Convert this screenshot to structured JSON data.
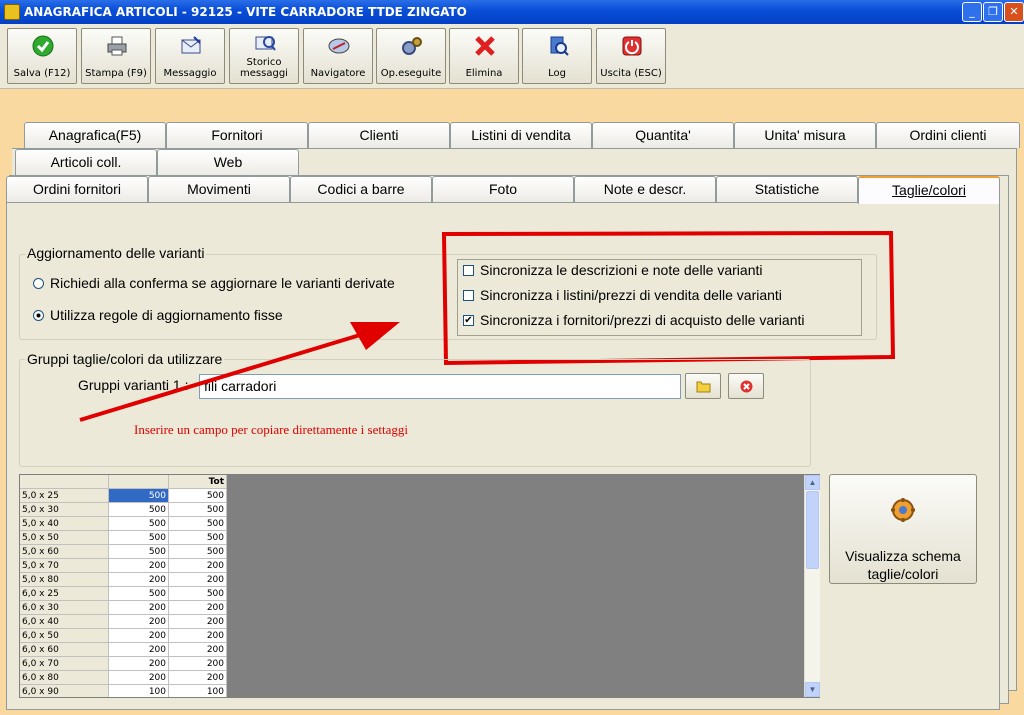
{
  "window": {
    "title": "ANAGRAFICA ARTICOLI - 92125 - VITE CARRADORE TTDE ZINGATO",
    "min": "_",
    "max": "❐",
    "close": "✕"
  },
  "toolbar": [
    {
      "label1": "Salva (F12)",
      "label2": "",
      "icon": "check-icon"
    },
    {
      "label1": "Stampa (F9)",
      "label2": "",
      "icon": "printer-icon"
    },
    {
      "label1": "Messaggio",
      "label2": "",
      "icon": "message-icon"
    },
    {
      "label1": "Storico",
      "label2": "messaggi",
      "icon": "message-history-icon"
    },
    {
      "label1": "Navigatore",
      "label2": "",
      "icon": "compass-icon"
    },
    {
      "label1": "Op.eseguite",
      "label2": "",
      "icon": "gears-icon"
    },
    {
      "label1": "Elimina",
      "label2": "",
      "icon": "delete-icon"
    },
    {
      "label1": "Log",
      "label2": "",
      "icon": "log-icon"
    },
    {
      "label1": "Uscita (ESC)",
      "label2": "",
      "icon": "power-icon"
    }
  ],
  "tabs": {
    "row1": [
      "Anagrafica(F5)",
      "Fornitori",
      "Clienti",
      "Listini di vendita",
      "Quantita'",
      "Unita' misura",
      "Ordini clienti"
    ],
    "row2": [
      "Articoli coll.",
      "Web"
    ],
    "row3": [
      "Ordini fornitori",
      "Movimenti",
      "Codici a barre",
      "Foto",
      "Note e descr.",
      "Statistiche",
      "Taglie/colori"
    ],
    "active": "Taglie/colori"
  },
  "varianti": {
    "title": "Aggiornamento delle varianti",
    "radio1": "Richiedi alla conferma se aggiornare le varianti derivate",
    "radio2": "Utilizza regole di aggiornamento fisse",
    "selected": 2,
    "chk1": "Sincronizza le descrizioni e note delle varianti",
    "chk2": "Sincronizza i listini/prezzi di vendita delle varianti",
    "chk3": "Sincronizza i fornitori/prezzi di acquisto delle varianti",
    "checked": [
      false,
      false,
      true
    ]
  },
  "gruppi": {
    "title": "Gruppi taglie/colori da utilizzare",
    "label": "Gruppi varianti 1 :",
    "value": "fili carradori"
  },
  "annotation": "Inserire un campo per copiare direttamente i settaggi",
  "grid": {
    "header_tot": "Tot",
    "rows": [
      [
        "5,0 x 25",
        "500",
        "500"
      ],
      [
        "5,0 x 30",
        "500",
        "500"
      ],
      [
        "5,0 x 40",
        "500",
        "500"
      ],
      [
        "5,0 x 50",
        "500",
        "500"
      ],
      [
        "5,0 x 60",
        "500",
        "500"
      ],
      [
        "5,0 x 70",
        "200",
        "200"
      ],
      [
        "5,0 x 80",
        "200",
        "200"
      ],
      [
        "6,0 x 25",
        "500",
        "500"
      ],
      [
        "6,0 x 30",
        "200",
        "200"
      ],
      [
        "6,0 x 40",
        "200",
        "200"
      ],
      [
        "6,0 x 50",
        "200",
        "200"
      ],
      [
        "6,0 x 60",
        "200",
        "200"
      ],
      [
        "6,0 x 70",
        "200",
        "200"
      ],
      [
        "6,0 x 80",
        "200",
        "200"
      ],
      [
        "6,0 x 90",
        "100",
        "100"
      ]
    ]
  },
  "schema_button": {
    "line1": "Visualizza schema",
    "line2": "taglie/colori"
  },
  "colors": {
    "highlight": "#e00000",
    "selection": "#316ac5"
  }
}
